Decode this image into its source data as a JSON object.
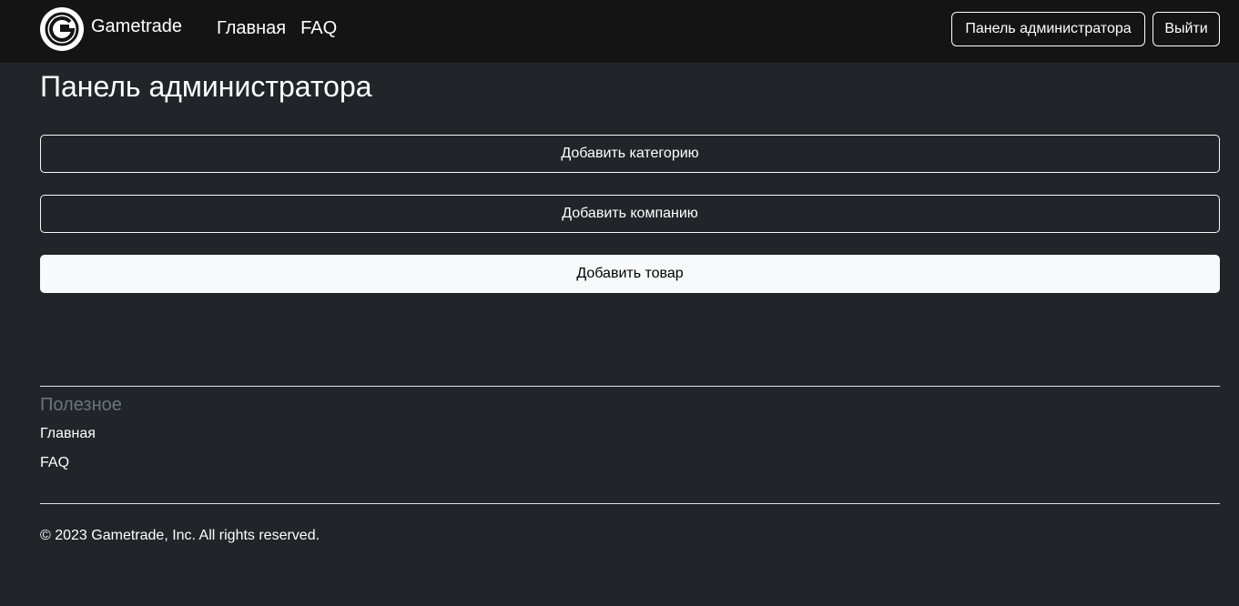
{
  "header": {
    "brand_name": "Gametrade",
    "nav": [
      "Главная",
      "FAQ"
    ],
    "admin_button": "Панель администратора",
    "logout_button": "Выйти"
  },
  "main": {
    "title": "Панель администратора",
    "actions": [
      "Добавить категорию",
      "Добавить компанию",
      "Добавить товар"
    ]
  },
  "footer": {
    "heading": "Полезное",
    "links": [
      "Главная",
      "FAQ"
    ],
    "copyright": "© 2023 Gametrade, Inc. All rights reserved."
  },
  "colors": {
    "navbar_bg": "#141414",
    "page_bg": "#212529",
    "light": "#f8f9fa",
    "muted": "#6c757d"
  },
  "icons": {
    "logo": "gametrade-g-logo-icon"
  }
}
